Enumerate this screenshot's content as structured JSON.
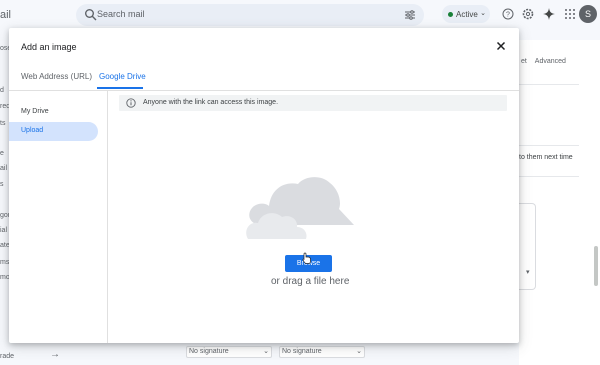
{
  "background": {
    "brand_fragment": "ail",
    "search": {
      "placeholder": "Search mail"
    },
    "status": {
      "label": "Active"
    },
    "avatar_initial": "S",
    "left_fragments": [
      "ose",
      "",
      "d",
      "red",
      "ts",
      "",
      "",
      "e",
      "ail",
      "s",
      "",
      "gori",
      "ial",
      "ates",
      "ms",
      "mo"
    ],
    "settings_tabs": [
      "et",
      "Advanced"
    ],
    "settings_text": "to them next time",
    "signatures": [
      "No signature",
      "No signature"
    ],
    "bottom_fragment": "rade",
    "accent": "#1a73e8"
  },
  "dialog": {
    "title": "Add an image",
    "tabs": [
      {
        "label": "Web Address (URL)",
        "active": false
      },
      {
        "label": "Google Drive",
        "active": true
      }
    ],
    "nav": [
      {
        "label": "My Drive",
        "selected": false
      },
      {
        "label": "Upload",
        "selected": true
      }
    ],
    "notice": "Anyone with the link can access this image.",
    "browse_label": "Browse",
    "drag_text": "or drag a file here",
    "icons": [
      "close-icon",
      "info-icon",
      "cloud-illustration",
      "search-icon",
      "filter-icon",
      "help-icon",
      "gear-icon",
      "sparkle-icon",
      "apps-grid-icon"
    ]
  }
}
